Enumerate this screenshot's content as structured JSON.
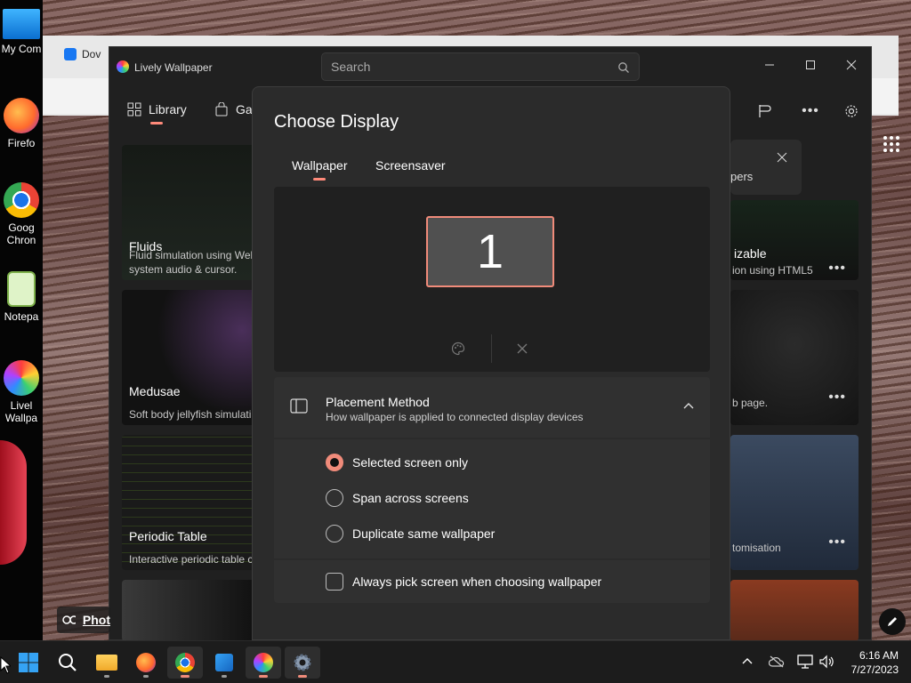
{
  "desktop": {
    "icons": [
      {
        "label": "My Com",
        "icon": "computer-icon"
      },
      {
        "label": "Firefo",
        "icon": "firefox-icon"
      },
      {
        "label": "Goog\nChron",
        "icon": "chrome-icon"
      },
      {
        "label": "Notepa",
        "icon": "notepad-icon"
      },
      {
        "label": "Livel\nWallpa",
        "icon": "lively-icon"
      }
    ]
  },
  "bg_browser": {
    "tab_label": "Dov"
  },
  "app": {
    "title": "Lively Wallpaper",
    "search_placeholder": "Search",
    "nav": {
      "library": "Library",
      "gallery": "Gal"
    },
    "toast_text": "pers",
    "cards_left": [
      {
        "title": "Fluids",
        "desc": "Fluid simulation using Wel\nsystem audio & cursor."
      },
      {
        "title": "Medusae",
        "desc": "Soft body jellyfish simulati"
      },
      {
        "title": "Periodic Table",
        "desc": "Interactive periodic table c"
      }
    ],
    "cards_right": [
      {
        "title": "izable",
        "desc": "ion using HTML5"
      },
      {
        "title": "",
        "desc": "b page."
      },
      {
        "title": "",
        "desc": "tomisation"
      }
    ],
    "photo_chip": "Phot"
  },
  "dialog": {
    "title": "Choose Display",
    "tabs": [
      "Wallpaper",
      "Screensaver"
    ],
    "monitor_number": "1",
    "placement": {
      "title": "Placement Method",
      "subtitle": "How wallpaper is applied to connected display devices",
      "options": [
        "Selected screen only",
        "Span across screens",
        "Duplicate same wallpaper"
      ],
      "selected": "Selected screen only"
    },
    "always_pick": "Always pick screen when choosing wallpaper"
  },
  "taskbar": {
    "time": "6:16 AM",
    "date": "7/27/2023"
  },
  "colors": {
    "accent": "#f08b7a",
    "dialog_bg": "#2b2b2b",
    "window_bg": "#202020"
  }
}
